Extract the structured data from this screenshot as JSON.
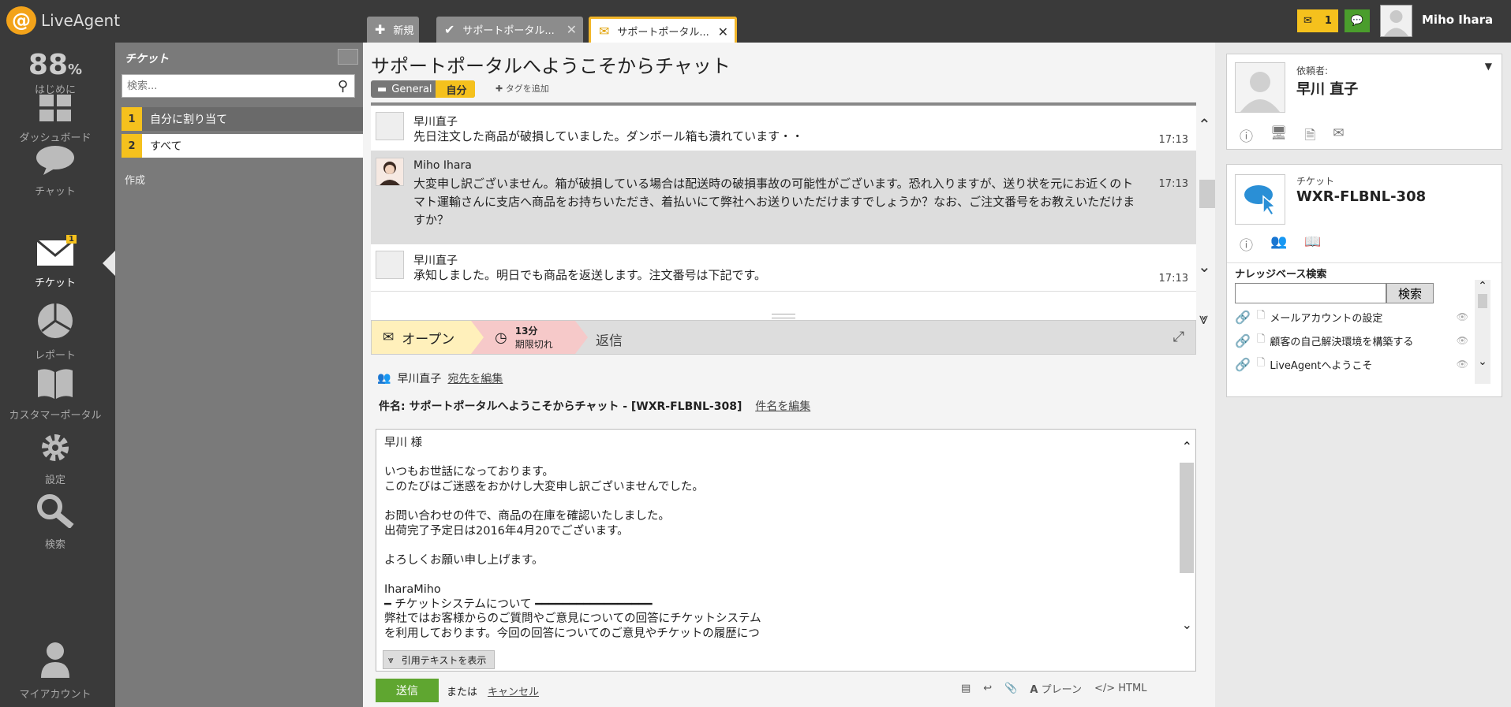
{
  "app": {
    "name": "LiveAgent",
    "logo_glyph": "@"
  },
  "tabs": [
    {
      "label": "新規",
      "icon": "plus-icon"
    },
    {
      "label": "サポートポータル...",
      "icon": "check-icon"
    },
    {
      "label": "サポートポータル...",
      "icon": "envelope-icon",
      "active": true
    }
  ],
  "header": {
    "mail_count": "1",
    "user_name": "Miho Ihara"
  },
  "nav": {
    "percent": "88",
    "percent_sign": "%",
    "intro": "はじめに",
    "dashboard": "ダッシュボード",
    "chat": "チャット",
    "tickets": "チケット",
    "tickets_badge": "1",
    "reports": "レポート",
    "portal": "カスタマーポータル",
    "settings": "設定",
    "search": "検索",
    "account": "マイアカウント"
  },
  "ticket_list": {
    "title": "チケット",
    "search_placeholder": "検索...",
    "rows": [
      {
        "num": "1",
        "label": "自分に割り当て"
      },
      {
        "num": "2",
        "label": "すべて"
      }
    ],
    "create": "作成"
  },
  "ticket": {
    "title": "サポートポータルへようこそからチャット",
    "dept": "General",
    "owner_tag": "自分",
    "add_tag": "タグを追加",
    "messages": [
      {
        "who": "早川直子",
        "body": "先日注文した商品が破損していました。ダンボール箱も潰れています・・",
        "time": "17:13"
      },
      {
        "who": "Miho Ihara",
        "body": "大変申し訳ございません。箱が破損している場合は配送時の破損事故の可能性がございます。恐れ入りますが、送り状を元にお近くのトマト運輸さんに支店へ商品をお持ちいただき、着払いにて弊社へお送りいただけますでしょうか？なお、ご注文番号をお教えいただけますか？",
        "time": "17:13"
      },
      {
        "who": "早川直子",
        "body": "承知しました。明日でも商品を返送します。注文番号は下記です。",
        "time": "17:13"
      }
    ],
    "status": {
      "open": "オープン",
      "time": "13分",
      "time_sub": "期限切れ",
      "reply": "返信"
    },
    "recipient": "早川直子",
    "edit_recipient": "宛先を編集",
    "subject": "件名: サポートポータルへようこそからチャット - [WXR-FLBNL-308]",
    "edit_subject": "件名を編集",
    "body": "早川 様\n\nいつもお世話になっております。\nこのたびはご迷惑をおかけし大変申し訳ございませんでした。\n\nお問い合わせの件で、商品の在庫を確認いたしました。\n出荷完了予定日は2016年4月20でございます。\n\nよろしくお願い申し上げます。\n\nIharaMiho\n━ チケットシステムについて ━━━━━━━━━━━━━━━━━\n弊社ではお客様からのご質問やご意見についての回答にチケットシステム\nを利用しております。今回の回答についてのご意見やチケットの履歴につ",
    "show_quote": "引用テキストを表示",
    "send": "送信",
    "or": "または",
    "cancel": "キャンセル",
    "toolbar": {
      "plain": "プレーン",
      "html": "HTML"
    }
  },
  "right": {
    "requester_label": "依頼者:",
    "requester_name": "早川 直子",
    "ticket_label": "チケット",
    "ticket_id": "WXR-FLBNL-308",
    "kb_title": "ナレッジベース検索",
    "kb_button": "検索",
    "kb_items": [
      "メールアカウントの設定",
      "顧客の自己解決環境を構築する",
      "LiveAgentへようこそ"
    ]
  }
}
